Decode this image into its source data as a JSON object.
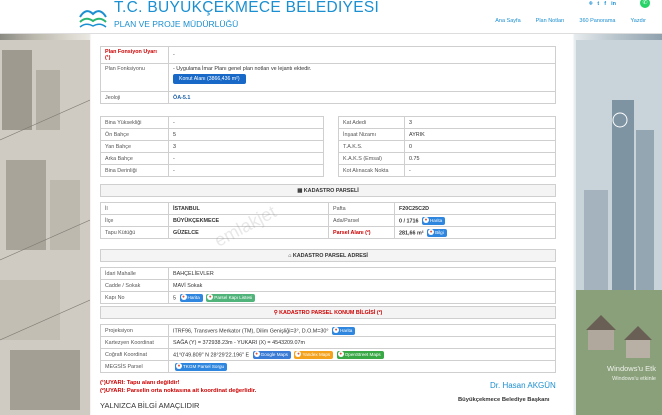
{
  "header": {
    "title": "T.C. BÜYÜKÇEKMECE BELEDİYESİ",
    "subtitle": "PLAN VE PROJE MÜDÜRLÜĞÜ",
    "nav": [
      "Ana Sayfa",
      "Plan Notları",
      "360 Panorama",
      "Yazdır"
    ],
    "social": [
      "⌾",
      "t",
      "f",
      "in"
    ],
    "whatsapp_glyph": "✆"
  },
  "plan": {
    "uyan_label": "Plan Fonsiyon Uyarı",
    "uyan_note": "(¹)",
    "uyan_value": "-",
    "fonksiyon_label": "Plan Fonksiyonu",
    "fonksiyon_value": "- Uygulama İmar Planı genel plan notları ve lejantı ektedir.",
    "konut_button": "Konut Alanı (3866,436 m²)",
    "jeoloji_label": "Jeoloji",
    "jeoloji_value": "ÖA-5.1"
  },
  "build_left": [
    {
      "label": "Bina Yüksekliği",
      "value": "-"
    },
    {
      "label": "Ön Bahçe",
      "value": "5"
    },
    {
      "label": "Yan Bahçe",
      "value": "3"
    },
    {
      "label": "Arka Bahçe",
      "value": "-"
    },
    {
      "label": "Bina Derinliği",
      "value": "-"
    }
  ],
  "build_right": [
    {
      "label": "Kat Adedi",
      "value": "3"
    },
    {
      "label": "İnşaat Nizamı",
      "value": "AYRIK"
    },
    {
      "label": "T.A.K.S.",
      "value": "0"
    },
    {
      "label": "K.A.K.S (Emsal)",
      "value": "0.75"
    },
    {
      "label": "Kot Alınacak Nokta",
      "value": "-"
    }
  ],
  "kadastro": {
    "heading": "KADASTRO PARSELİ",
    "il_label": "İl",
    "il_value": "İSTANBUL",
    "ilce_label": "İlçe",
    "ilce_value": "BÜYÜKÇEKMECE",
    "tapu_label": "Tapu Kütüğü",
    "tapu_value": "GÜZELCE",
    "pafta_label": "Pafta",
    "pafta_value": "F20C25C2D",
    "ada_label": "Ada/Parsel",
    "ada_value": "0 / 1716",
    "parsel_label": "Parsel Alanı",
    "parsel_note": "(²)",
    "parsel_value": "281,66 m²",
    "harita_chip": "Harita",
    "bilgi_chip": "Bilgi"
  },
  "adres": {
    "heading": "KADASTRO PARSEL ADRESİ",
    "rows": [
      {
        "label": "İdari Mahalle",
        "value": "BAHÇELİEVLER"
      },
      {
        "label": "Cadde / Sokak",
        "value": "MAVİ Sokak"
      }
    ],
    "kapi_label": "Kapı No",
    "kapi_value": "5",
    "harita_chip": "Harita",
    "kapi_chip": "Parsel Kapı Listesi"
  },
  "konum": {
    "heading": "KADASTRO PARSEL KONUM BİLGİSİ",
    "heading_note": "(²)",
    "projeksiyon_label": "Projeksiyon",
    "projeksiyon_value": "ITRF96, Transvers Merkator (TM), Dilim Genişliği=3°, D.O.M=30°",
    "kartezyen_label": "Kartezyen Koordinat",
    "kartezyen_value": "SAĞA (Y) = 372938.23m - YUKARI (X) = 4543209.07m",
    "cografi_label": "Coğrafi Koordinat",
    "cografi_value": "41°0'49.809\" N 28°29'22.196\" E",
    "megsis_label": "MEGSİS Parsel",
    "chips": {
      "harita": "Harita",
      "google": "Google Maps",
      "yandex": "Yandex Maps",
      "osm": "OpenStreet Maps",
      "tkgm": "TKGM Parsel Sorgu"
    }
  },
  "notes": {
    "uyari1": "(¹)UYARI: Tapu alanı değildir!",
    "uyari2": "(²)UYARI: Parselin orta noktasına ait koordinat değerlidir.",
    "yalnizca": "YALNIZCA BİLGİ AMAÇLIDIR"
  },
  "signature": {
    "name": "Dr. Hasan AKGÜN",
    "org": "Büyükçekmece Belediye Başkanı"
  },
  "watermark": "emlakjet",
  "windows": {
    "line1": "Windows'u Etk",
    "line2": "Windows'u etkinle"
  },
  "colors": {
    "brand": "#1a8fd1",
    "warning": "#cc0000",
    "button": "#1768c7"
  }
}
